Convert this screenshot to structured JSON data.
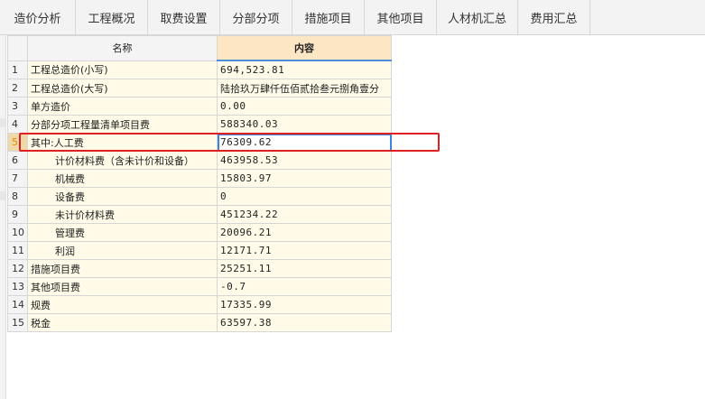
{
  "tabs": [
    {
      "label": "造价分析",
      "active": true
    },
    {
      "label": "工程概况",
      "active": false
    },
    {
      "label": "取费设置",
      "active": false
    },
    {
      "label": "分部分项",
      "active": false
    },
    {
      "label": "措施项目",
      "active": false
    },
    {
      "label": "其他项目",
      "active": false
    },
    {
      "label": "人材机汇总",
      "active": false
    },
    {
      "label": "费用汇总",
      "active": false
    }
  ],
  "table": {
    "headers": {
      "name": "名称",
      "content": "内容"
    },
    "rows": [
      {
        "num": "1",
        "name": "工程总造价(小写)",
        "value": "694,523.81",
        "indent": false
      },
      {
        "num": "2",
        "name": "工程总造价(大写)",
        "value": "陆拾玖万肆仟伍佰贰拾叁元捌角壹分",
        "indent": false
      },
      {
        "num": "3",
        "name": "单方造价",
        "value": "0.00",
        "indent": false
      },
      {
        "num": "4",
        "name": "分部分项工程量清单项目费",
        "value": "588340.03",
        "indent": false
      },
      {
        "num": "5",
        "name": "其中:人工费",
        "value": "76309.62",
        "indent": false,
        "selected": true
      },
      {
        "num": "6",
        "name": "计价材料费（含未计价和设备）",
        "value": "463958.53",
        "indent": true
      },
      {
        "num": "7",
        "name": "机械费",
        "value": "15803.97",
        "indent": true
      },
      {
        "num": "8",
        "name": "设备费",
        "value": "0",
        "indent": true
      },
      {
        "num": "9",
        "name": "未计价材料费",
        "value": "451234.22",
        "indent": true
      },
      {
        "num": "10",
        "name": "管理费",
        "value": "20096.21",
        "indent": true
      },
      {
        "num": "11",
        "name": "利润",
        "value": "12171.71",
        "indent": true
      },
      {
        "num": "12",
        "name": "措施项目费",
        "value": "25251.11",
        "indent": false
      },
      {
        "num": "13",
        "name": "其他项目费",
        "value": "-0.7",
        "indent": false
      },
      {
        "num": "14",
        "name": "规费",
        "value": "17335.99",
        "indent": false
      },
      {
        "num": "15",
        "name": "税金",
        "value": "63597.38",
        "indent": false
      }
    ]
  },
  "colors": {
    "accent": "#2f7fd6",
    "highlight": "#e02020",
    "header_content": "#fde6c4",
    "cell_bg": "#fffbe8"
  }
}
